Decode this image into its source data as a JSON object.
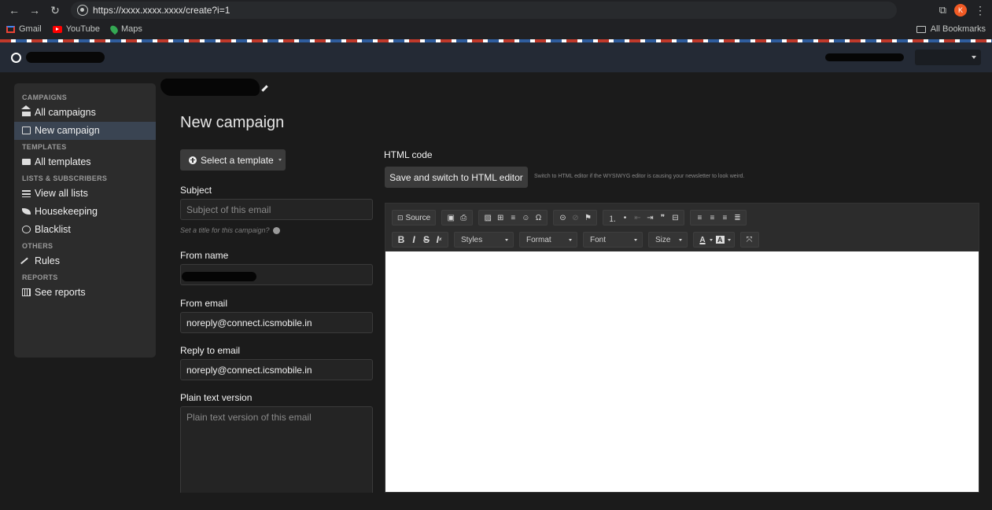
{
  "browser": {
    "url": "https://xxxx.xxxx.xxxx/create?i=1",
    "profile_initial": "K",
    "bookmarks": [
      {
        "label": "Gmail"
      },
      {
        "label": "YouTube"
      },
      {
        "label": "Maps"
      }
    ],
    "all_bookmarks": "All Bookmarks"
  },
  "sidebar": {
    "sections": [
      {
        "header": "CAMPAIGNS",
        "items": [
          {
            "label": "All campaigns",
            "icon": "home-icon"
          },
          {
            "label": "New campaign",
            "icon": "edit-icon",
            "active": true
          }
        ]
      },
      {
        "header": "TEMPLATES",
        "items": [
          {
            "label": "All templates",
            "icon": "envelope-icon"
          }
        ]
      },
      {
        "header": "LISTS & SUBSCRIBERS",
        "items": [
          {
            "label": "View all lists",
            "icon": "list-icon"
          },
          {
            "label": "Housekeeping",
            "icon": "leaf-icon"
          },
          {
            "label": "Blacklist",
            "icon": "ban-icon"
          }
        ]
      },
      {
        "header": "OTHERS",
        "items": [
          {
            "label": "Rules",
            "icon": "wand-icon"
          }
        ]
      },
      {
        "header": "REPORTS",
        "items": [
          {
            "label": "See reports",
            "icon": "chart-icon"
          }
        ]
      }
    ]
  },
  "main": {
    "title": "New campaign",
    "template_button": "Select a template",
    "subject_label": "Subject",
    "subject_placeholder": "Subject of this email",
    "subject_hint": "Set a title for this campaign?",
    "from_name_label": "From name",
    "from_email_label": "From email",
    "from_email_value": "noreply@connect.icsmobile.in",
    "reply_to_label": "Reply to email",
    "reply_to_value": "noreply@connect.icsmobile.in",
    "plain_text_label": "Plain text version",
    "plain_text_placeholder": "Plain text version of this email"
  },
  "editor": {
    "label": "HTML code",
    "switch_button": "Save and switch to HTML editor",
    "switch_hint": "Switch to HTML editor if the WYSIWYG editor is causing your newsletter to look weird.",
    "source_label": "Source",
    "combos": [
      "Styles",
      "Format",
      "Font",
      "Size"
    ]
  }
}
